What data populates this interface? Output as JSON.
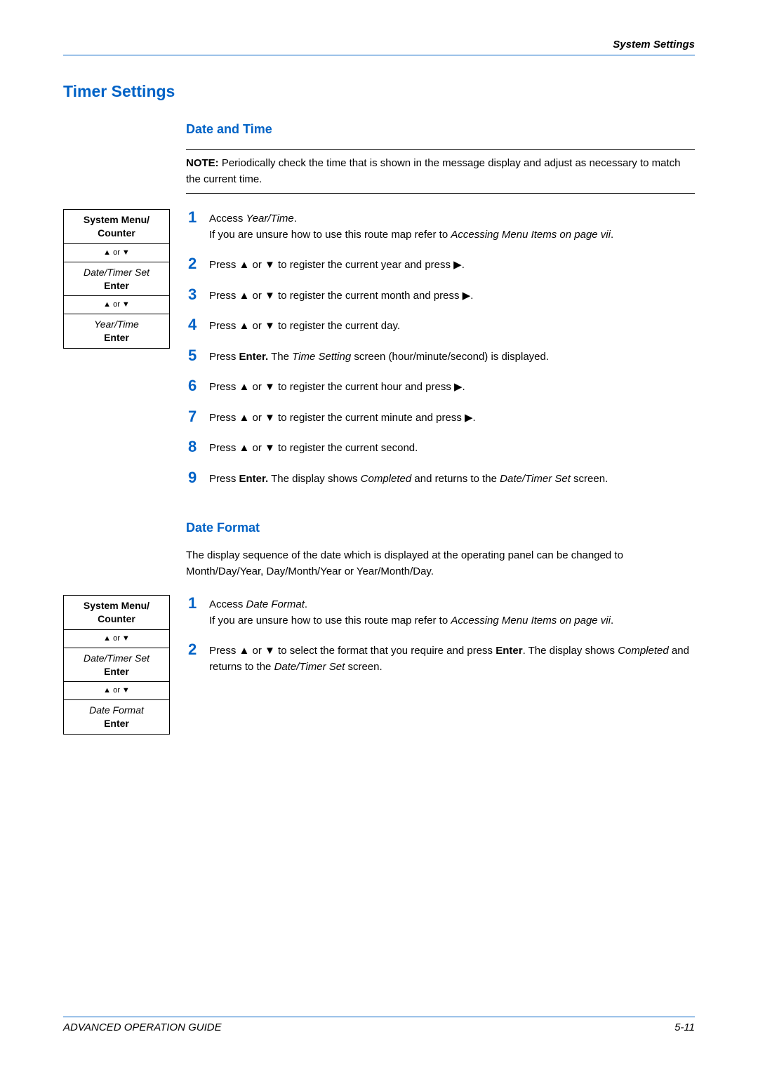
{
  "header": {
    "title": "System Settings"
  },
  "h1": "Timer Settings",
  "section1": {
    "heading": "Date and Time",
    "note_label": "NOTE:",
    "note_text": " Periodically check the time that is shown in the message display and adjust as necessary to match the current time.",
    "route": {
      "r1a": "System Menu/",
      "r1b": "Counter",
      "r2": "▲ or ▼",
      "r3a": "Date/Timer Set",
      "r3b": "Enter",
      "r4": "▲ or ▼",
      "r5a": "Year/Time",
      "r5b": "Enter"
    },
    "steps": {
      "s1a": "Access ",
      "s1b": "Year/Time",
      "s1c": ".",
      "s1d": "If you are unsure how to use this route map refer to ",
      "s1e": "Accessing Menu Items on page vii",
      "s1f": ".",
      "s2": "Press ▲ or ▼ to register the current year and press ▶.",
      "s3": "Press ▲ or ▼ to register the current month and press ▶.",
      "s4": "Press ▲ or ▼ to register the current day.",
      "s5a": "Press ",
      "s5b": "Enter.",
      "s5c": " The ",
      "s5d": "Time Setting",
      "s5e": " screen (hour/minute/second) is displayed.",
      "s6": "Press ▲ or ▼ to register the current hour and press ▶.",
      "s7": "Press ▲ or ▼ to register the current minute and press ▶.",
      "s8": "Press ▲ or ▼ to register the current second.",
      "s9a": "Press ",
      "s9b": "Enter.",
      "s9c": " The display shows ",
      "s9d": "Completed",
      "s9e": " and returns to the ",
      "s9f": "Date/Timer Set",
      "s9g": " screen."
    }
  },
  "section2": {
    "heading": "Date Format",
    "intro": "The display sequence of the date which is displayed at the operating panel can be changed to Month/Day/Year, Day/Month/Year or Year/Month/Day.",
    "route": {
      "r1a": "System Menu/",
      "r1b": "Counter",
      "r2": "▲ or ▼",
      "r3a": "Date/Timer Set",
      "r3b": "Enter",
      "r4": "▲ or ▼",
      "r5a": "Date Format",
      "r5b": "Enter"
    },
    "steps": {
      "s1a": "Access ",
      "s1b": "Date Format",
      "s1c": ".",
      "s1d": "If you are unsure how to use this route map refer to ",
      "s1e": "Accessing Menu Items on page vii",
      "s1f": ".",
      "s2a": "Press ▲ or ▼ to select the format that you require and press ",
      "s2b": "Enter",
      "s2c": ". The display shows ",
      "s2d": "Completed",
      "s2e": " and returns to the ",
      "s2f": "Date/Timer Set",
      "s2g": " screen."
    }
  },
  "footer": {
    "left": "ADVANCED OPERATION GUIDE",
    "right": "5-11"
  },
  "nums": {
    "n1": "1",
    "n2": "2",
    "n3": "3",
    "n4": "4",
    "n5": "5",
    "n6": "6",
    "n7": "7",
    "n8": "8",
    "n9": "9"
  }
}
